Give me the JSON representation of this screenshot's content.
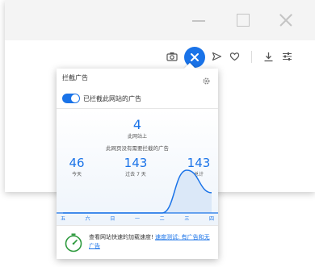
{
  "popup": {
    "title": "拦截广告",
    "toggle_label": "已拦截此网站的广告",
    "page_blocked_count": "4",
    "page_blocked_label": "此网站上",
    "page_message": "此网页没有需要拦截的广告",
    "today": {
      "value": "46",
      "label": "今天"
    },
    "week": {
      "value": "143",
      "label": "过去 7 天"
    },
    "total": {
      "value": "143",
      "label": "总计"
    },
    "footer": {
      "text": "查看网站快速的加载速度!",
      "link": "速度测试: 有广告和无广告"
    }
  },
  "icons": {
    "toolbar": [
      "camera-icon",
      "ad-blocker-icon",
      "send-icon",
      "heart-icon",
      "download-icon",
      "settings-sliders-icon"
    ],
    "window": [
      "minimize-icon",
      "maximize-icon",
      "close-icon"
    ]
  },
  "colors": {
    "accent": "#1a73e8"
  },
  "chart_data": {
    "type": "area",
    "categories": [
      "五",
      "六",
      "日",
      "一",
      "二",
      "三",
      "四"
    ],
    "values": [
      0,
      0,
      0,
      0,
      0,
      97,
      46
    ],
    "title": "",
    "xlabel": "",
    "ylabel": ""
  }
}
